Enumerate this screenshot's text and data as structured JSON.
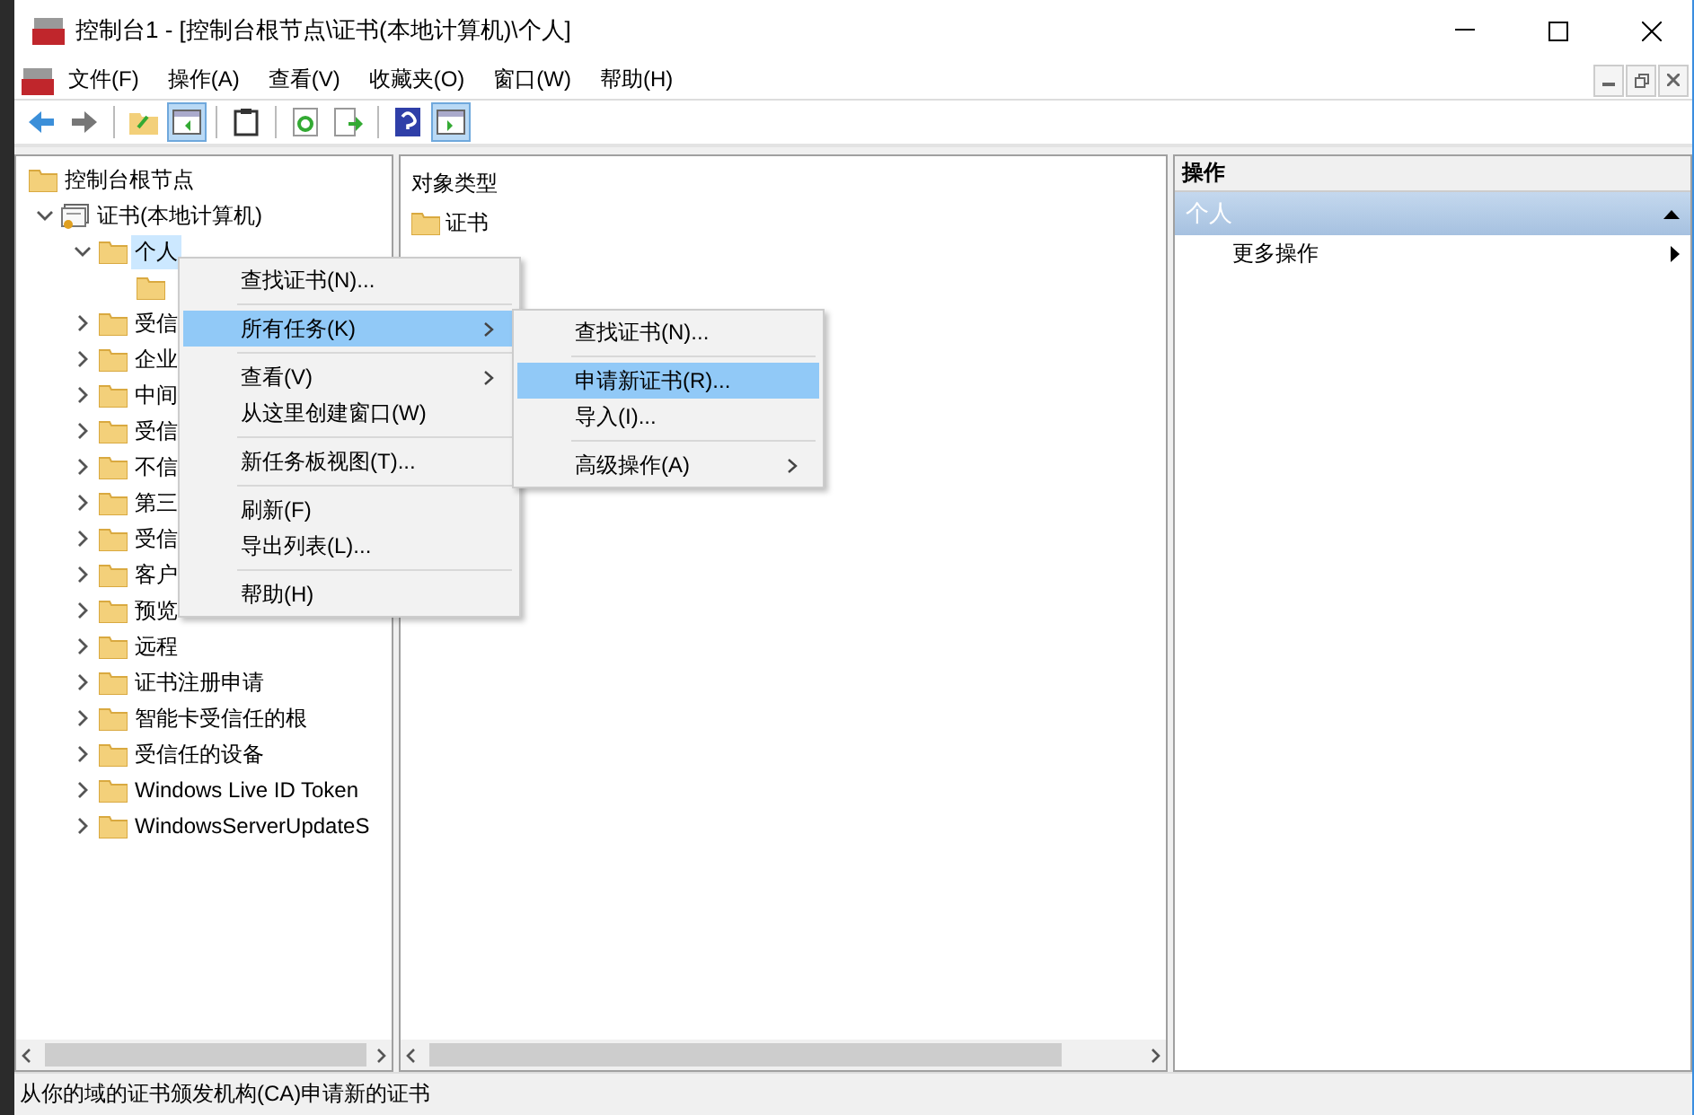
{
  "window": {
    "title": "控制台1 - [控制台根节点\\证书(本地计算机)\\个人]"
  },
  "menu_bar": [
    "文件(F)",
    "操作(A)",
    "查看(V)",
    "收藏夹(O)",
    "窗口(W)",
    "帮助(H)"
  ],
  "toolbar": [
    {
      "kind": "back",
      "on": false
    },
    {
      "kind": "forward",
      "on": false
    },
    {
      "kind": "sep"
    },
    {
      "kind": "up",
      "on": false
    },
    {
      "kind": "tree",
      "on": true
    },
    {
      "kind": "sep"
    },
    {
      "kind": "clipboard",
      "on": false
    },
    {
      "kind": "sep"
    },
    {
      "kind": "refresh",
      "on": false
    },
    {
      "kind": "export",
      "on": false
    },
    {
      "kind": "sep"
    },
    {
      "kind": "help",
      "on": false
    },
    {
      "kind": "actionpane",
      "on": true
    }
  ],
  "tree": [
    {
      "kind": "root",
      "label": "控制台根节点",
      "children": [
        {
          "kind": "cert",
          "label": "证书(本地计算机)",
          "expanded": true,
          "selected": false,
          "children": [
            {
              "kind": "folder",
              "label": "个人",
              "expanded": true,
              "selected": true,
              "children": [
                {
                  "kind": "folder"
                }
              ]
            },
            {
              "kind": "folder",
              "label": "受信",
              "expanded": false,
              "selected": false
            },
            {
              "kind": "folder",
              "label": "企业",
              "expanded": false,
              "selected": false
            },
            {
              "kind": "folder",
              "label": "中间",
              "expanded": false,
              "selected": false
            },
            {
              "kind": "folder",
              "label": "受信",
              "expanded": false,
              "selected": false
            },
            {
              "kind": "folder",
              "label": "不信",
              "expanded": false,
              "selected": false
            },
            {
              "kind": "folder",
              "label": "第三",
              "expanded": false,
              "selected": false
            },
            {
              "kind": "folder",
              "label": "受信",
              "expanded": false,
              "selected": false
            },
            {
              "kind": "folder",
              "label": "客户",
              "expanded": false,
              "selected": false
            },
            {
              "kind": "folder",
              "label": "预览",
              "expanded": false,
              "selected": false
            },
            {
              "kind": "folder",
              "label": "远程",
              "expanded": false,
              "selected": false
            },
            {
              "kind": "folder",
              "label": "证书注册申请",
              "expanded": false,
              "selected": false
            },
            {
              "kind": "folder",
              "label": "智能卡受信任的根",
              "expanded": false,
              "selected": false
            },
            {
              "kind": "folder",
              "label": "受信任的设备",
              "expanded": false,
              "selected": false
            },
            {
              "kind": "folder",
              "label": "Windows Live ID Token",
              "expanded": false,
              "selected": false
            },
            {
              "kind": "folder",
              "label": "WindowsServerUpdateS",
              "expanded": false,
              "selected": false
            }
          ]
        }
      ]
    }
  ],
  "object_list": {
    "header": "对象类型",
    "items": [
      "证书"
    ]
  },
  "actions": {
    "header": "操作",
    "section": {
      "label": "个人",
      "expanded": true
    },
    "items": [
      {
        "label": "更多操作",
        "submenu": true
      }
    ]
  },
  "context_menu": [
    {
      "kind": "item",
      "label": "查找证书(N)...",
      "submenu": false,
      "selected": false
    },
    {
      "kind": "separator"
    },
    {
      "kind": "item",
      "label": "所有任务(K)",
      "submenu": true,
      "selected": true
    },
    {
      "kind": "separator"
    },
    {
      "kind": "item",
      "label": "查看(V)",
      "submenu": true,
      "selected": false
    },
    {
      "kind": "item",
      "label": "从这里创建窗口(W)",
      "submenu": false,
      "selected": false
    },
    {
      "kind": "separator"
    },
    {
      "kind": "item",
      "label": "新任务板视图(T)...",
      "submenu": false,
      "selected": false
    },
    {
      "kind": "separator"
    },
    {
      "kind": "item",
      "label": "刷新(F)",
      "submenu": false,
      "selected": false
    },
    {
      "kind": "item",
      "label": "导出列表(L)...",
      "submenu": false,
      "selected": false
    },
    {
      "kind": "separator"
    },
    {
      "kind": "item",
      "label": "帮助(H)",
      "submenu": false,
      "selected": false
    }
  ],
  "submenu": [
    {
      "kind": "item",
      "label": "查找证书(N)...",
      "submenu": false,
      "selected": false
    },
    {
      "kind": "separator"
    },
    {
      "kind": "item",
      "label": "申请新证书(R)...",
      "submenu": false,
      "selected": true
    },
    {
      "kind": "item",
      "label": "导入(I)...",
      "submenu": false,
      "selected": false
    },
    {
      "kind": "separator"
    },
    {
      "kind": "item",
      "label": "高级操作(A)",
      "submenu": true,
      "selected": false
    }
  ],
  "status_bar": "从你的域的证书颁发机构(CA)申请新的证书"
}
